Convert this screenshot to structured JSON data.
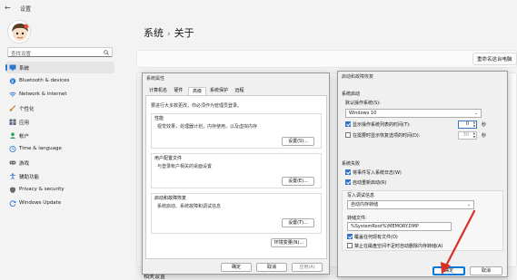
{
  "app": {
    "title": "设置",
    "back_glyph": "←"
  },
  "search": {
    "placeholder": "查找设置"
  },
  "sidebar": {
    "items": [
      {
        "label": "系统",
        "icon": "monitor-icon",
        "color": "#2b79d3",
        "selected": true
      },
      {
        "label": "Bluetooth & devices",
        "icon": "bluetooth-icon",
        "color": "#2b79d3"
      },
      {
        "label": "Network & internet",
        "icon": "wifi-icon",
        "color": "#2b79d3"
      },
      {
        "label": "个性化",
        "icon": "brush-icon",
        "color": "#d77e2b"
      },
      {
        "label": "应用",
        "icon": "apps-icon",
        "color": "#5a6a80"
      },
      {
        "label": "帐户",
        "icon": "account-icon",
        "color": "#2fa05a"
      },
      {
        "label": "Time & language",
        "icon": "globe-clock-icon",
        "color": "#2b79d3"
      },
      {
        "label": "游戏",
        "icon": "gamepad-icon",
        "color": "#6a6a6a"
      },
      {
        "label": "辅助功能",
        "icon": "accessibility-icon",
        "color": "#2b79d3"
      },
      {
        "label": "Privacy & security",
        "icon": "shield-icon",
        "color": "#6a6a6a"
      },
      {
        "label": "Windows Update",
        "icon": "update-icon",
        "color": "#2b79d3"
      }
    ]
  },
  "main": {
    "breadcrumb_parent": "系统",
    "breadcrumb_sep": "›",
    "breadcrumb_current": "关于",
    "rename_button": "重命名这台电脑",
    "related_title": "相关设置"
  },
  "sysprops": {
    "title": "系统属性",
    "tabs": [
      "计算机名",
      "硬件",
      "高级",
      "系统保护",
      "远程"
    ],
    "active_tab": "高级",
    "admin_note": "要进行大多数更改，你必须作为管理员登录。",
    "perf": {
      "title": "性能",
      "desc": "视觉效果，处理器计划，内存使用，以及虚拟内存",
      "button": "设置(S)..."
    },
    "profile": {
      "title": "用户配置文件",
      "desc": "与登录帐户相关的桌面设置",
      "button": "设置(E)..."
    },
    "startup": {
      "title": "启动和故障恢复",
      "desc": "系统启动、系统故障和调试信息",
      "button": "设置(T)..."
    },
    "env_button": "环境变量(N)...",
    "ok": "确定",
    "cancel": "取消",
    "apply": "应用(A)"
  },
  "startup_dlg": {
    "title": "启动和故障恢复",
    "sys_start": "系统启动",
    "default_os_label": "默认操作系统(S):",
    "default_os": "Windows 10",
    "show_os_list": "显示操作系统列表的时间(T):",
    "show_os_list_value": "0",
    "show_recovery": "在需要时显示恢复选项的时间(D):",
    "show_recovery_value": "30",
    "seconds": "秒",
    "sys_failure": "系统失败",
    "write_event": "将事件写入系统日志(W)",
    "auto_restart": "自动重新启动(R)",
    "debug_info": "写入调试信息",
    "debug_option": "自动内存转储",
    "dump_file_label": "转储文件:",
    "dump_file": "%SystemRoot%\\MEMORY.DMP",
    "overwrite": "覆盖任何现有文件(O)",
    "disable_auto_delete": "禁止在磁盘空间不足时自动删除内存转储(A)",
    "ok": "确定",
    "cancel": "取消",
    "arrow_color": "#d9302a"
  }
}
